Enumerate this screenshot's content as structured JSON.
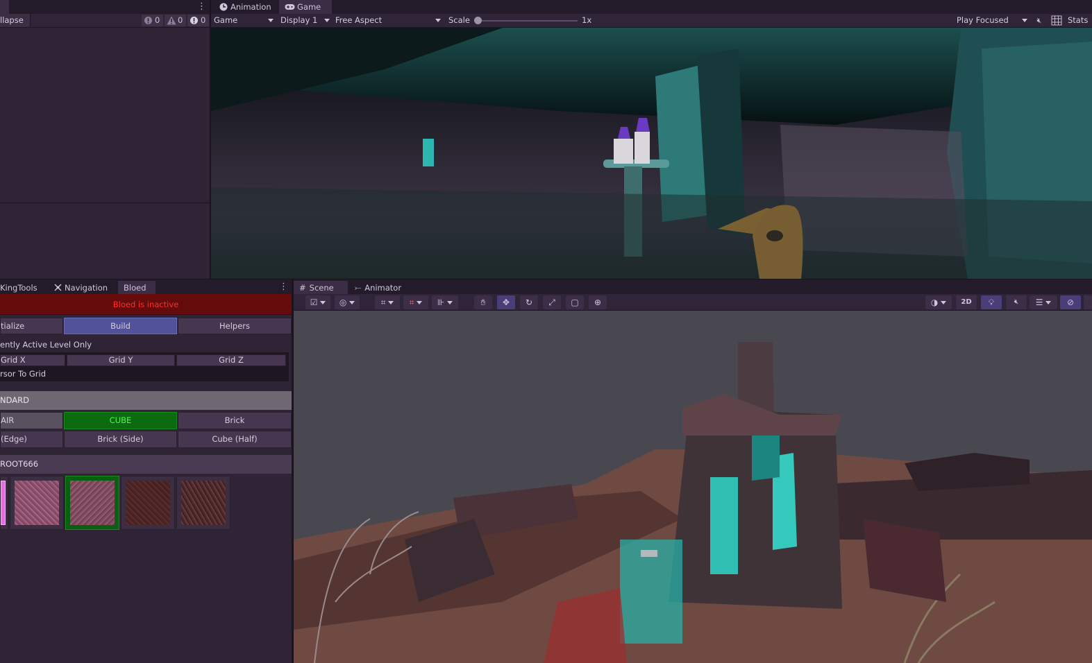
{
  "console": {
    "collapse_label": "llapse",
    "errors": "0",
    "warnings": "0",
    "infos": "0"
  },
  "game_view": {
    "tabs": [
      "Animation",
      "Game"
    ],
    "mode": "Game",
    "display": "Display 1",
    "aspect": "Free Aspect",
    "scale_label": "Scale",
    "scale_value": "1x",
    "play_mode": "Play Focused",
    "stats_label": "Stats"
  },
  "left_tabs": [
    "KingTools",
    "Navigation",
    "Bloed"
  ],
  "bloed": {
    "status": "Bloed is inactive",
    "mode_buttons": [
      "tialize",
      "Build",
      "Helpers"
    ],
    "active_level_label": "ently Active Level Only",
    "grid_buttons": [
      "Grid X",
      "Grid Y",
      "Grid Z"
    ],
    "cursor_label": "rsor To Grid",
    "standard_header": "NDARD",
    "shape_row1": [
      "AIR",
      "CUBE",
      "Brick"
    ],
    "shape_row2": [
      " (Edge)",
      "Brick (Side)",
      "Cube (Half)"
    ],
    "material_header": "ROOT666"
  },
  "scene_view": {
    "tabs": [
      "Scene",
      "Animator"
    ],
    "toggle_2d": "2D"
  },
  "colors": {
    "status_bg": "#650b0b",
    "status_text": "#ff2d2d",
    "build_active": "#52529a",
    "cube_active": "#0c6b10",
    "cube_text": "#44ff44"
  }
}
